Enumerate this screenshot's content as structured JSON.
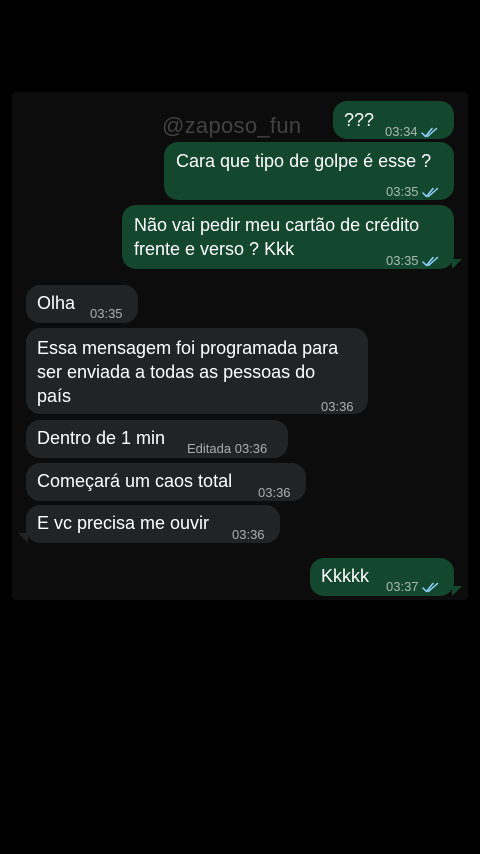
{
  "watermark": "@zaposo_fun",
  "messages": [
    {
      "text": "???",
      "time": "03:34",
      "direction": "outgoing",
      "status": "read"
    },
    {
      "text": "Cara que tipo de golpe é esse ?",
      "time": "03:35",
      "direction": "outgoing",
      "status": "read"
    },
    {
      "lines": [
        "Não vai pedir meu cartão de crédito",
        "frente e verso ? Kkk"
      ],
      "time": "03:35",
      "direction": "outgoing",
      "status": "read"
    },
    {
      "text": "Olha",
      "time": "03:35",
      "direction": "incoming"
    },
    {
      "lines": [
        "Essa mensagem foi programada para",
        "ser enviada a todas as pessoas do",
        "país"
      ],
      "time": "03:36",
      "direction": "incoming"
    },
    {
      "text": "Dentro de 1 min",
      "edited_label": "Editada",
      "time": "03:36",
      "direction": "incoming"
    },
    {
      "text": "Começará um caos total",
      "time": "03:36",
      "direction": "incoming"
    },
    {
      "text": "E vc precisa me ouvir",
      "time": "03:36",
      "direction": "incoming"
    },
    {
      "text": "Kkkkk",
      "time": "03:37",
      "direction": "outgoing",
      "status": "read"
    }
  ],
  "colors": {
    "outgoing_bubble": "#13472e",
    "incoming_bubble": "#222325",
    "read_ticks": "#8fd3ff",
    "background": "#000000"
  },
  "icons": {
    "read_receipt": "double-check-icon"
  }
}
